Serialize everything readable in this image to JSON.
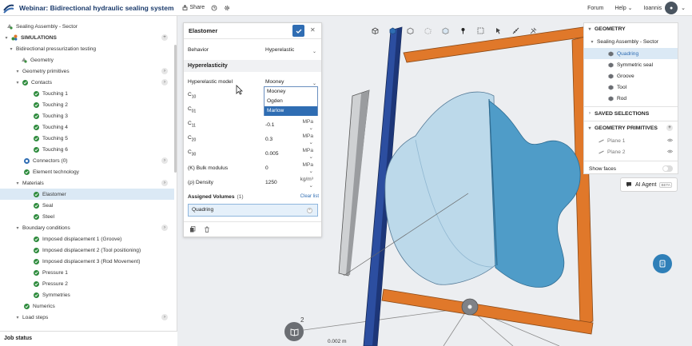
{
  "topbar": {
    "title": "Webinar: Bidirectional hydraulic sealing system",
    "share_label": "Share",
    "forum_label": "Forum",
    "help_label": "Help",
    "user_name": "Ioannis"
  },
  "tree": {
    "rows": [
      {
        "label": "Sealing Assembly - Sector",
        "indent": 8,
        "kind": "geo",
        "selected": false,
        "plus": false
      },
      {
        "label": "SIMULATIONS",
        "indent": 4,
        "kind": "sim",
        "selected": false,
        "plus": true
      },
      {
        "label": "Bidirectional pressurization testing",
        "indent": 10,
        "kind": "caret",
        "selected": false,
        "plus": false
      },
      {
        "label": "Geometry",
        "indent": 26,
        "kind": "geo",
        "selected": false,
        "plus": false
      },
      {
        "label": "Geometry primitives",
        "indent": 18,
        "kind": "caret",
        "selected": false,
        "plus": true
      },
      {
        "label": "Contacts",
        "indent": 18,
        "kind": "caret-check",
        "selected": false,
        "plus": true
      },
      {
        "label": "Touching 1",
        "indent": 42,
        "kind": "check",
        "selected": false,
        "plus": false
      },
      {
        "label": "Touching 2",
        "indent": 42,
        "kind": "check",
        "selected": false,
        "plus": false
      },
      {
        "label": "Touching 3",
        "indent": 42,
        "kind": "check",
        "selected": false,
        "plus": false
      },
      {
        "label": "Touching 4",
        "indent": 42,
        "kind": "check",
        "selected": false,
        "plus": false
      },
      {
        "label": "Touching 5",
        "indent": 42,
        "kind": "check",
        "selected": false,
        "plus": false
      },
      {
        "label": "Touching 6",
        "indent": 42,
        "kind": "check",
        "selected": false,
        "plus": false
      },
      {
        "label": "Connectors (0)",
        "indent": 30,
        "kind": "blue",
        "selected": false,
        "plus": true
      },
      {
        "label": "Element technology",
        "indent": 30,
        "kind": "check",
        "selected": false,
        "plus": false
      },
      {
        "label": "Materials",
        "indent": 18,
        "kind": "caret",
        "selected": false,
        "plus": true
      },
      {
        "label": "Elastomer",
        "indent": 42,
        "kind": "check",
        "selected": true,
        "plus": false
      },
      {
        "label": "Seal",
        "indent": 42,
        "kind": "check",
        "selected": false,
        "plus": false
      },
      {
        "label": "Steel",
        "indent": 42,
        "kind": "check",
        "selected": false,
        "plus": false
      },
      {
        "label": "Boundary conditions",
        "indent": 18,
        "kind": "caret",
        "selected": false,
        "plus": true
      },
      {
        "label": "Imposed displacement 1 (Groove)",
        "indent": 42,
        "kind": "check",
        "selected": false,
        "plus": false
      },
      {
        "label": "Imposed displacement 2 (Tool positioning)",
        "indent": 42,
        "kind": "check",
        "selected": false,
        "plus": false
      },
      {
        "label": "Imposed displacement 3 (Rod Movement)",
        "indent": 42,
        "kind": "check",
        "selected": false,
        "plus": false
      },
      {
        "label": "Pressure 1",
        "indent": 42,
        "kind": "check",
        "selected": false,
        "plus": false
      },
      {
        "label": "Pressure 2",
        "indent": 42,
        "kind": "check",
        "selected": false,
        "plus": false
      },
      {
        "label": "Symmetries",
        "indent": 42,
        "kind": "check",
        "selected": false,
        "plus": false
      },
      {
        "label": "Numerics",
        "indent": 30,
        "kind": "check",
        "selected": false,
        "plus": false
      },
      {
        "label": "Load steps",
        "indent": 18,
        "kind": "caret",
        "selected": false,
        "plus": true
      }
    ],
    "job_status_label": "Job status"
  },
  "dialog": {
    "title": "Elastomer",
    "behavior_label": "Behavior",
    "behavior_value": "Hyperelastic",
    "section_label": "Hyperelasticity",
    "model_label": "Hyperelastic model",
    "model_value": "Mooney",
    "dropdown_options": [
      "Mooney",
      "Ogden",
      "Marlow"
    ],
    "dropdown_highlighted": "Marlow",
    "params": [
      {
        "key": "C",
        "sub": "10",
        "value": "",
        "unit": ""
      },
      {
        "key": "C",
        "sub": "01",
        "value": "",
        "unit": ""
      },
      {
        "key": "C",
        "sub": "11",
        "value": "-0.1",
        "unit": "MPa"
      },
      {
        "key": "C",
        "sub": "20",
        "value": "0.3",
        "unit": "MPa"
      },
      {
        "key": "C",
        "sub": "30",
        "value": "0.005",
        "unit": "MPa"
      }
    ],
    "bulk_label": "(K) Bulk modulus",
    "bulk_value": "0",
    "bulk_unit": "MPa",
    "density_label": "(ρ) Density",
    "density_value": "1250",
    "density_unit": "kg/m³",
    "assigned_label": "Assigned Volumes",
    "assigned_count": "(1)",
    "clear_label": "Clear list",
    "assigned_item": "Quadring"
  },
  "geometry_panel": {
    "header": "GEOMETRY",
    "assembly": "Sealing Assembly - Sector",
    "parts": [
      "Quadring",
      "Symmetric seal",
      "Groove",
      "Tool",
      "Rod"
    ],
    "selected_part": "Quadring",
    "saved_selections_label": "SAVED SELECTIONS",
    "primitives_label": "GEOMETRY PRIMITIVES",
    "primitives": [
      "Plane 1",
      "Plane 2"
    ],
    "show_faces_label": "Show faces"
  },
  "ai_agent": {
    "label": "AI Agent",
    "badge": "BETA"
  },
  "viewport": {
    "scale_label": "0.002 m",
    "axis_number": "2"
  },
  "colors": {
    "brand": "#1a3a6b",
    "accent": "#2f6db3",
    "check": "#2e8b3d",
    "selection": "#dbe9f5",
    "seal": "#5aa3cc",
    "frame": "#e0782a",
    "rod": "#2c4ea0"
  }
}
